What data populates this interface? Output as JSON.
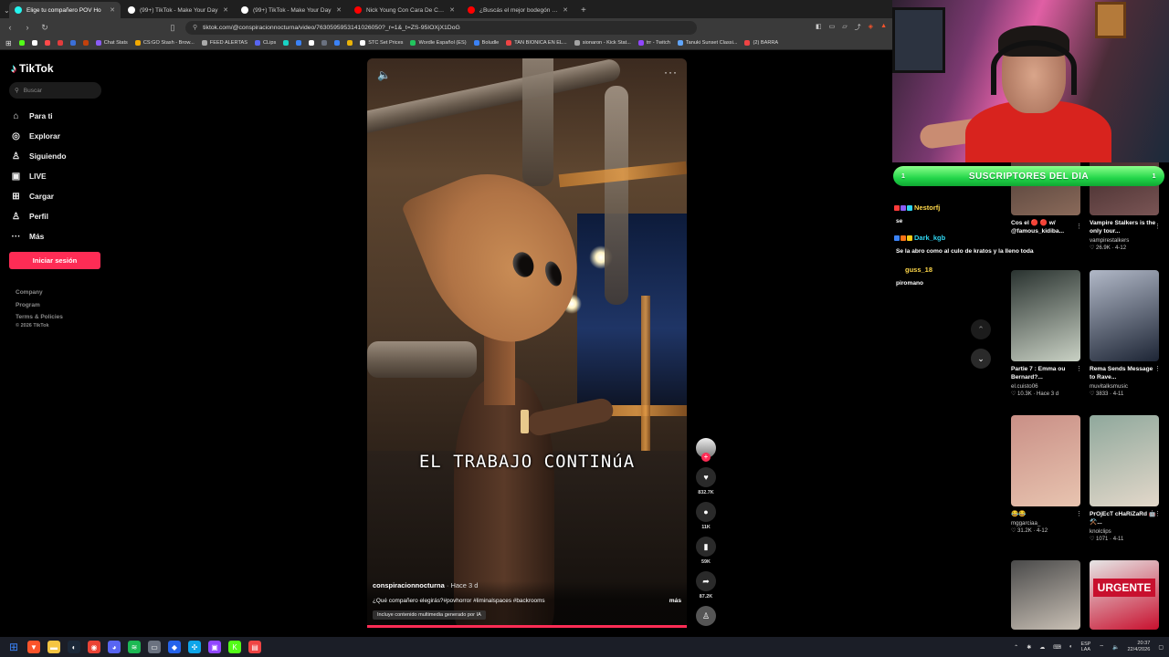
{
  "browser": {
    "tabs": [
      {
        "title": "Elige tu compañero POV Ho",
        "active": true,
        "color": "#25f4ee"
      },
      {
        "title": "(99+) TikTok - Make Your Day",
        "active": false,
        "color": "#ffffff"
      },
      {
        "title": "(99+) TikTok - Make Your Day",
        "active": false,
        "color": "#ffffff"
      },
      {
        "title": "Nick Young Con Cara De Confundid",
        "active": false,
        "color": "#ff0000"
      },
      {
        "title": "¿Buscás el mejor bodegón de Villa C",
        "active": false,
        "color": "#ff0000"
      }
    ],
    "url": "tiktok.com/@conspiracionnocturna/video/7630595953141026050?_r=1&_t=ZS-95IOXjX1DoG",
    "bookmarks": [
      {
        "label": "",
        "color": "#53fc18"
      },
      {
        "label": "",
        "color": "#ffffff"
      },
      {
        "label": "",
        "color": "#ff4a4a"
      },
      {
        "label": "",
        "color": "#e23c3c"
      },
      {
        "label": "",
        "color": "#3b6fd8"
      },
      {
        "label": "",
        "color": "#c2410c"
      },
      {
        "label": "Chat Stats",
        "color": "#8a5cf6"
      },
      {
        "label": "CS:GO Stash - Brow...",
        "color": "#f2a900"
      },
      {
        "label": "FEED ALERTAS",
        "color": "#aaaaaa"
      },
      {
        "label": "CLips",
        "color": "#5865f2"
      },
      {
        "label": "",
        "color": "#19d3c5"
      },
      {
        "label": "",
        "color": "#3b82f6"
      },
      {
        "label": "",
        "color": "#ffffff"
      },
      {
        "label": "",
        "color": "#6b7280"
      },
      {
        "label": "",
        "color": "#3b82f6"
      },
      {
        "label": "",
        "color": "#eab308"
      },
      {
        "label": "STC Set Prices",
        "color": "#ffffff"
      },
      {
        "label": "Wordle Español (ES)",
        "color": "#22c55e"
      },
      {
        "label": "Boludle",
        "color": "#3b82f6"
      },
      {
        "label": "TAN BIONICA EN EL...",
        "color": "#ef4444"
      },
      {
        "label": "sionaron - Kick Stat...",
        "color": "#a3a3a3"
      },
      {
        "label": "trr - Twitch",
        "color": "#9146ff"
      },
      {
        "label": "Tanuki Sunset Classi...",
        "color": "#60a5fa"
      },
      {
        "label": "(2) BARRA",
        "color": "#ef4444"
      }
    ]
  },
  "tiktok": {
    "logo": "TikTok",
    "search_placeholder": "Buscar",
    "nav": [
      {
        "label": "Para ti",
        "icon": "home-icon",
        "glyph": "⌂"
      },
      {
        "label": "Explorar",
        "icon": "compass-icon",
        "glyph": "◎"
      },
      {
        "label": "Siguiendo",
        "icon": "following-icon",
        "glyph": "♙"
      },
      {
        "label": "LIVE",
        "icon": "live-icon",
        "glyph": "▣"
      },
      {
        "label": "Cargar",
        "icon": "upload-icon",
        "glyph": "⊞"
      },
      {
        "label": "Perfil",
        "icon": "profile-icon",
        "glyph": "♙"
      },
      {
        "label": "Más",
        "icon": "more-icon",
        "glyph": "···"
      }
    ],
    "login_label": "Iniciar sesión",
    "footer": [
      "Company",
      "Program",
      "Terms & Policies"
    ],
    "copyright": "© 2026 TikTok"
  },
  "video": {
    "overlay_text": "EL TRABAJO CONTINúA",
    "author": "conspiracionnocturna",
    "posted": "· Hace 3 d",
    "description": "¿Qué compañero elegirás?#povhorror #liminalspaces #backrooms",
    "more_label": "más",
    "ai_label": "Incluye contenido multimedia generado por IA",
    "likes": "832.7K",
    "comments": "11K",
    "saves": "59K",
    "shares": "87.2K"
  },
  "stream": {
    "banner": "SUSCRIPTORES DEL DIA",
    "banner_count": "1",
    "chat": [
      {
        "user": "Nestorfj",
        "color": "#ffd84a",
        "text": "se"
      },
      {
        "user": "Dark_kgb",
        "color": "#2fd5f0",
        "text": "Se la abro como al culo de kratos y la lleno toda"
      },
      {
        "user": "guss_18",
        "color": "#ffd84a",
        "text": "piromano"
      }
    ]
  },
  "feed": [
    {
      "title": "Cos el 🔴 🔴 w/ @famous_kidiba...",
      "user": "",
      "stats": "",
      "colors": [
        "#3a2d2a",
        "#8a6a5a"
      ]
    },
    {
      "title": "Vampire Stalkers is the only tour...",
      "user": "vampirestalkers",
      "stats": "♡ 26.9K · 4-12",
      "colors": [
        "#2a1a1a",
        "#7a5555"
      ]
    },
    {
      "title": "Partie 7 : Emma ou Bernard?...",
      "user": "el.cuisto06",
      "stats": "♡ 10.3K · Hace 3 d",
      "colors": [
        "#2a3330",
        "#c9d1c4"
      ]
    },
    {
      "title": "Rema Sends Message to Rave...",
      "user": "muvitalksmusic",
      "stats": "♡ 3833 · 4-11",
      "colors": [
        "#b1b8c7",
        "#1d2535"
      ]
    },
    {
      "title": "😂😂",
      "user": "mggarciaa_",
      "stats": "♡ 31.2K · 4-12",
      "colors": [
        "#c98f86",
        "#e8c4b0"
      ]
    },
    {
      "title": "PrOjEcT cHaRiZaRd 🤖 ⚒️...",
      "user": "knolclips",
      "stats": "♡ 1071 · 4-11",
      "colors": [
        "#8fa89c",
        "#e3d8ca"
      ]
    },
    {
      "title": "",
      "user": "",
      "stats": "",
      "colors": [
        "#4a4a4a",
        "#c9c0b5"
      ]
    },
    {
      "title": "URGENTE",
      "user": "",
      "stats": "",
      "colors": [
        "#e6e6e6",
        "#c8102e"
      ]
    }
  ],
  "taskbar": {
    "apps": [
      {
        "icon": "windows-start-icon",
        "color": "#3b82f6",
        "glyph": "⊞"
      },
      {
        "icon": "brave-icon",
        "color": "#fb542b",
        "glyph": "▼"
      },
      {
        "icon": "file-explorer-icon",
        "color": "#f5c542",
        "glyph": "▬"
      },
      {
        "icon": "steam-icon",
        "color": "#1b2838",
        "glyph": "◐"
      },
      {
        "icon": "chrome-icon",
        "color": "#ea4335",
        "glyph": "◉"
      },
      {
        "icon": "discord-icon",
        "color": "#5865f2",
        "glyph": "◕"
      },
      {
        "icon": "spotify-icon",
        "color": "#1db954",
        "glyph": "≋"
      },
      {
        "icon": "app-icon",
        "color": "#6b7280",
        "glyph": "▭"
      },
      {
        "icon": "valorant-icon",
        "color": "#2563eb",
        "glyph": "◆"
      },
      {
        "icon": "app-icon",
        "color": "#0ea5e9",
        "glyph": "✣"
      },
      {
        "icon": "twitch-icon",
        "color": "#9146ff",
        "glyph": "▣"
      },
      {
        "icon": "kick-icon",
        "color": "#53fc18",
        "glyph": "K"
      },
      {
        "icon": "obs-icon",
        "color": "#ef4444",
        "glyph": "▤"
      }
    ],
    "lang": "ESP",
    "lang2": "LAA",
    "time": "20:37",
    "date": "22/4/2026"
  }
}
